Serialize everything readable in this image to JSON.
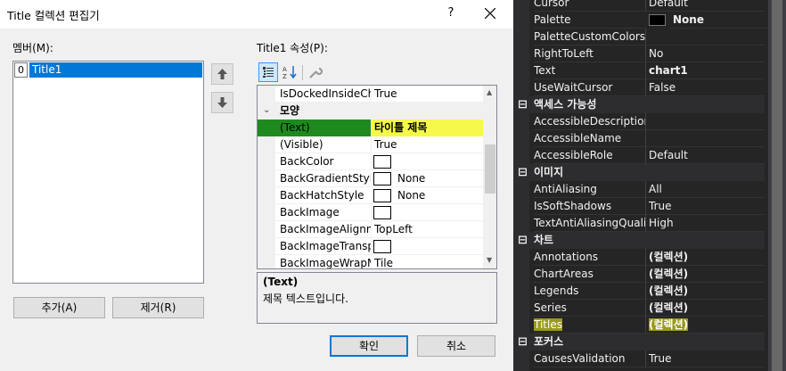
{
  "dialog": {
    "title": "Title 컬렉션 편집기",
    "help_label": "?",
    "members_label": "멤버(M):",
    "properties_label": "Title1 속성(P):",
    "members": [
      {
        "index": "0",
        "name": "Title1"
      }
    ],
    "buttons": {
      "add": "추가(A)",
      "remove": "제거(R)",
      "ok": "확인",
      "cancel": "취소"
    },
    "grid": {
      "rows": [
        {
          "name": "IsDockedInsideCha",
          "value": "True"
        },
        {
          "category": "모양"
        },
        {
          "name": "(Text)",
          "value": "타이틀 제목"
        },
        {
          "name": "(Visible)",
          "value": "True"
        },
        {
          "name": "BackColor",
          "value": ""
        },
        {
          "name": "BackGradientStyle",
          "value": "None"
        },
        {
          "name": "BackHatchStyle",
          "value": "None"
        },
        {
          "name": "BackImage",
          "value": ""
        },
        {
          "name": "BackImageAlignme",
          "value": "TopLeft"
        },
        {
          "name": "BackImageTranspa",
          "value": ""
        },
        {
          "name": "BackImageWrapMo",
          "value": "Tile"
        }
      ],
      "description_title": "(Text)",
      "description_text": "제목 텍스트입니다."
    }
  },
  "properties_panel": {
    "rows": [
      {
        "name": "Cursor",
        "value": "Default"
      },
      {
        "name": "Palette",
        "value": "None",
        "bold": true,
        "swatch": true
      },
      {
        "name": "PaletteCustomColors",
        "value": ""
      },
      {
        "name": "RightToLeft",
        "value": "No"
      },
      {
        "name": "Text",
        "value": "chart1",
        "bold": true
      },
      {
        "name": "UseWaitCursor",
        "value": "False"
      },
      {
        "category": "액세스 가능성"
      },
      {
        "name": "AccessibleDescription",
        "value": ""
      },
      {
        "name": "AccessibleName",
        "value": ""
      },
      {
        "name": "AccessibleRole",
        "value": "Default"
      },
      {
        "category": "이미지"
      },
      {
        "name": "AntiAliasing",
        "value": "All"
      },
      {
        "name": "IsSoftShadows",
        "value": "True"
      },
      {
        "name": "TextAntiAliasingQuality",
        "value": "High"
      },
      {
        "category": "차트"
      },
      {
        "name": "Annotations",
        "value": "(컬렉션)",
        "bold": true
      },
      {
        "name": "ChartAreas",
        "value": "(컬렉션)",
        "bold": true
      },
      {
        "name": "Legends",
        "value": "(컬렉션)",
        "bold": true
      },
      {
        "name": "Series",
        "value": "(컬렉션)",
        "bold": true
      },
      {
        "name": "Titles",
        "value": "(컬렉션)",
        "bold": true
      },
      {
        "category": "포커스"
      },
      {
        "name": "CausesValidation",
        "value": "True"
      }
    ]
  },
  "colors": {
    "accent": "#0078d7",
    "highlight_yellow": "#f5f94a",
    "highlight_green": "#1e8a1e",
    "dark_panel": "#252526"
  }
}
